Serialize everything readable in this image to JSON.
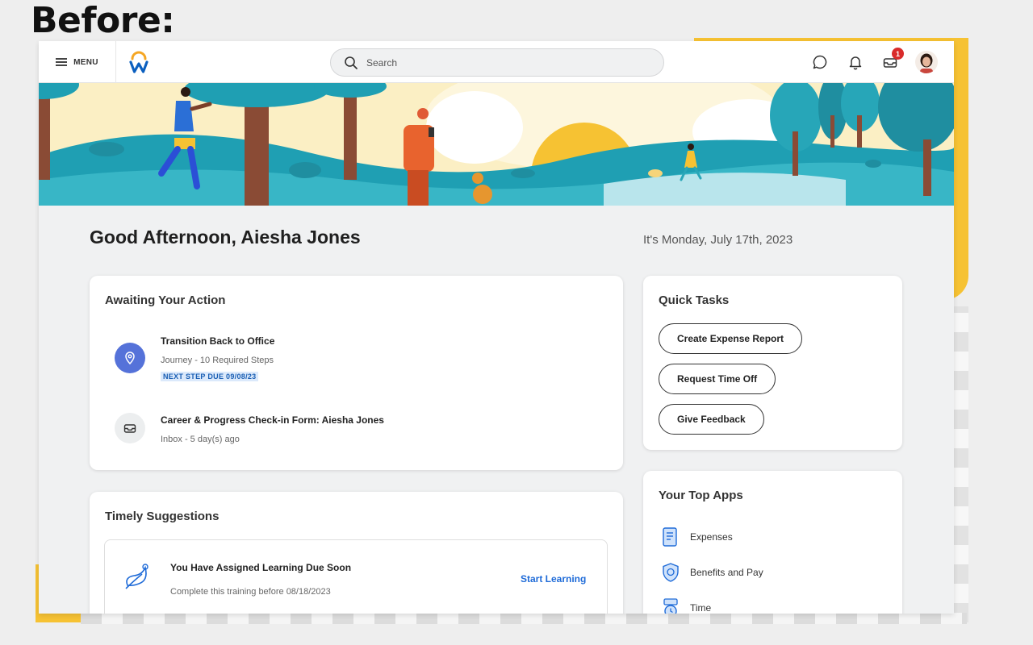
{
  "caption": "Before:",
  "nav": {
    "menu_label": "MENU",
    "search_placeholder": "Search",
    "notification_badge": "1"
  },
  "greeting": "Good Afternoon, Aiesha Jones",
  "date": "It's Monday, July 17th, 2023",
  "awaiting": {
    "title": "Awaiting Your Action",
    "items": [
      {
        "title": "Transition Back to Office",
        "subtitle": "Journey - 10 Required Steps",
        "tag": "NEXT STEP DUE 09/08/23",
        "icon": "location-pin-icon"
      },
      {
        "title": "Career & Progress Check-in Form: Aiesha Jones",
        "subtitle": "Inbox - 5 day(s) ago",
        "icon": "inbox-icon"
      }
    ]
  },
  "timely": {
    "title": "Timely Suggestions",
    "suggestion": {
      "title": "You Have Assigned Learning Due Soon",
      "subtitle": "Complete this training before 08/18/2023",
      "action": "Start Learning",
      "icon": "learning-icon"
    }
  },
  "quick_tasks": {
    "title": "Quick Tasks",
    "buttons": [
      "Create Expense Report",
      "Request Time Off",
      "Give Feedback"
    ]
  },
  "top_apps": {
    "title": "Your Top Apps",
    "apps": [
      {
        "label": "Expenses",
        "icon": "expenses-icon"
      },
      {
        "label": "Benefits and Pay",
        "icon": "benefits-shield-icon"
      },
      {
        "label": "Time",
        "icon": "time-icon"
      }
    ]
  },
  "colors": {
    "accent_blue": "#1f6bd8",
    "brand_orange": "#f5a623",
    "brand_blue": "#0b5fbf",
    "banner_yellow": "#f6c233",
    "banner_teal": "#27a6b8",
    "badge_red": "#d92b2b"
  }
}
